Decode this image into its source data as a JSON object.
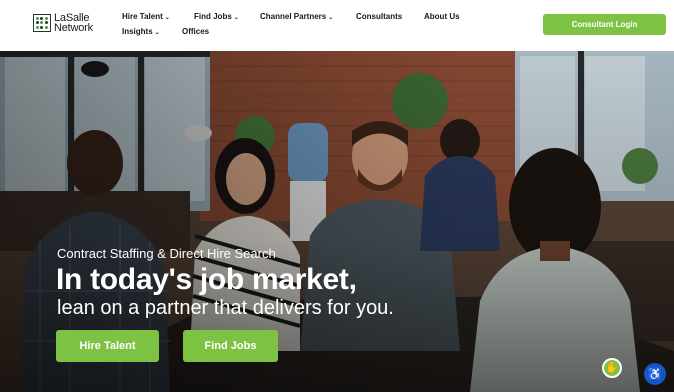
{
  "header": {
    "logo_line1": "LaSalle",
    "logo_line2": "Network",
    "nav": [
      {
        "label": "Hire Talent",
        "has_menu": true
      },
      {
        "label": "Find Jobs",
        "has_menu": true
      },
      {
        "label": "Channel Partners",
        "has_menu": true
      },
      {
        "label": "Consultants",
        "has_menu": false
      },
      {
        "label": "About Us",
        "has_menu": false
      },
      {
        "label": "Insights",
        "has_menu": true
      },
      {
        "label": "Offices",
        "has_menu": false
      }
    ],
    "login_label": "Consultant Login"
  },
  "hero": {
    "eyebrow": "Contract Staffing & Direct Hire Search",
    "headline": "In today's job market,",
    "subhead": "lean on a partner that delivers for you.",
    "buttons": [
      {
        "label": "Hire Talent"
      },
      {
        "label": "Find Jobs"
      }
    ],
    "image": "office-meeting-photo"
  },
  "widgets": {
    "chat_icon": "accessibility-widget-icon",
    "access_icon": "accessibility-icon"
  },
  "colors": {
    "accent": "#7dc243",
    "header_bg": "#ffffff",
    "access_blue": "#1556c7"
  }
}
